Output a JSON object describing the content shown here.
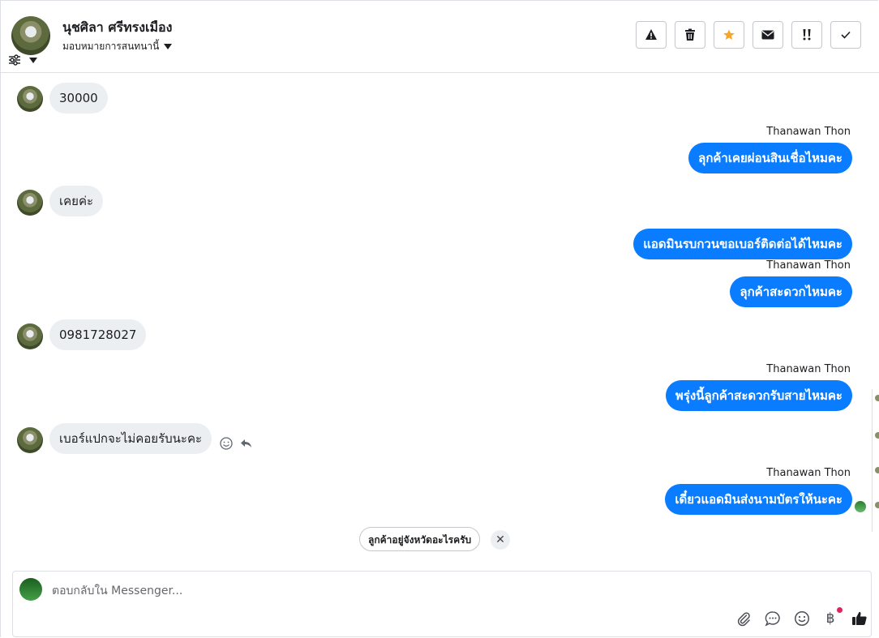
{
  "header": {
    "name": "นุชศิลา ศรีทรงเมือง",
    "assign_label": "มอบหมายการสนทนานี้"
  },
  "messages": [
    {
      "dir": "in",
      "text": "30000"
    },
    {
      "dir": "out",
      "sender": "Thanawan Thon",
      "text": "ลุกค้าเคยผ่อนสินเชื่อไหมคะ"
    },
    {
      "dir": "in",
      "text": "เคยค่ะ"
    },
    {
      "dir": "out",
      "text": "แอดมินรบกวนขอเบอร์ติดต่อได้ไหมคะ"
    },
    {
      "dir": "out",
      "sender": "Thanawan Thon",
      "text": "ลุกค้าสะดวกไหมคะ"
    },
    {
      "dir": "in",
      "text": "0981728027"
    },
    {
      "dir": "out",
      "sender": "Thanawan Thon",
      "text": "พรุ่งนี้ลูกค้าสะดวกรับสายไหมคะ"
    },
    {
      "dir": "in",
      "text": "เบอร์แปกจะไม่คอยรับนะคะ"
    },
    {
      "dir": "out",
      "sender": "Thanawan Thon",
      "text": "เดี๋ยวแอดมินส่งนามบัตรให้นะคะ"
    }
  ],
  "suggestion": "ลูกค้าอยู่จังหวัดอะไรครับ",
  "composer": {
    "placeholder": "ตอบกลับใน Messenger...",
    "baht_symbol": "฿"
  },
  "colors": {
    "outgoing_bubble": "#0a7cff",
    "incoming_bubble": "#eceff1",
    "star": "#f5a623"
  }
}
